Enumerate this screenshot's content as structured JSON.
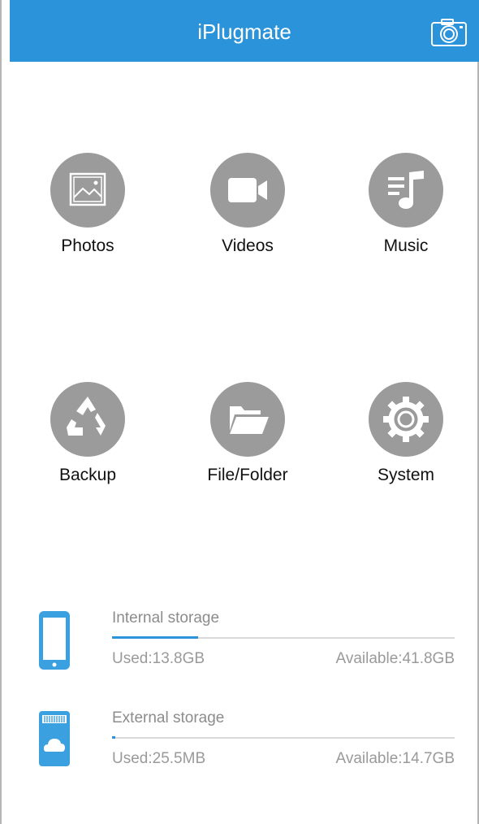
{
  "header": {
    "title": "iPlugmate",
    "camera_icon": "camera-icon",
    "color": "#2b93d9"
  },
  "menu": [
    {
      "label": "Photos",
      "icon": "photos-icon"
    },
    {
      "label": "Videos",
      "icon": "videos-icon"
    },
    {
      "label": "Music",
      "icon": "music-icon"
    },
    {
      "label": "Backup",
      "icon": "backup-icon"
    },
    {
      "label": "File/Folder",
      "icon": "folder-icon"
    },
    {
      "label": "System",
      "icon": "gear-icon"
    }
  ],
  "storage": {
    "internal": {
      "title": "Internal storage",
      "used": "Used:13.8GB",
      "available": "Available:41.8GB",
      "used_fraction": 0.25
    },
    "external": {
      "title": "External storage",
      "used": "Used:25.5MB",
      "available": "Available:14.7GB",
      "used_fraction": 0.01
    }
  },
  "colors": {
    "accent": "#2b93d9",
    "icon_gray": "#9b9b9b"
  }
}
